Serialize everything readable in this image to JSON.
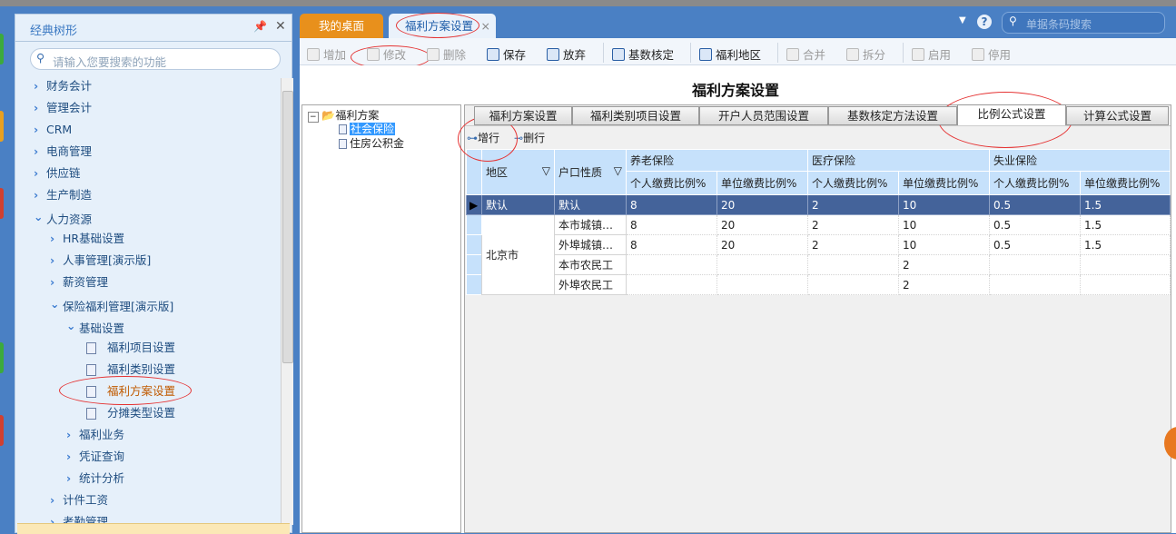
{
  "sidebar": {
    "title": "经典树形",
    "search_placeholder": "请输入您要搜索的功能",
    "items": [
      {
        "label": "财务会计",
        "level": 0,
        "state": "collapsed"
      },
      {
        "label": "管理会计",
        "level": 0,
        "state": "collapsed"
      },
      {
        "label": "CRM",
        "level": 0,
        "state": "collapsed"
      },
      {
        "label": "电商管理",
        "level": 0,
        "state": "collapsed"
      },
      {
        "label": "供应链",
        "level": 0,
        "state": "collapsed"
      },
      {
        "label": "生产制造",
        "level": 0,
        "state": "collapsed"
      },
      {
        "label": "人力资源",
        "level": 0,
        "state": "expanded"
      },
      {
        "label": "HR基础设置",
        "level": 1,
        "state": "collapsed"
      },
      {
        "label": "人事管理[演示版]",
        "level": 1,
        "state": "collapsed"
      },
      {
        "label": "薪资管理",
        "level": 1,
        "state": "collapsed"
      },
      {
        "label": "保险福利管理[演示版]",
        "level": 1,
        "state": "expanded"
      },
      {
        "label": "基础设置",
        "level": 2,
        "state": "expanded"
      },
      {
        "label": "福利项目设置",
        "level": 3,
        "state": "leaf"
      },
      {
        "label": "福利类别设置",
        "level": 3,
        "state": "leaf"
      },
      {
        "label": "福利方案设置",
        "level": 3,
        "state": "leaf",
        "active": true
      },
      {
        "label": "分摊类型设置",
        "level": 3,
        "state": "leaf"
      },
      {
        "label": "福利业务",
        "level": 2,
        "state": "collapsed"
      },
      {
        "label": "凭证查询",
        "level": 2,
        "state": "collapsed"
      },
      {
        "label": "统计分析",
        "level": 2,
        "state": "collapsed"
      },
      {
        "label": "计件工资",
        "level": 1,
        "state": "collapsed"
      },
      {
        "label": "考勤管理",
        "level": 1,
        "state": "collapsed"
      }
    ]
  },
  "tabs": [
    {
      "label": "我的桌面"
    },
    {
      "label": "福利方案设置",
      "active": true,
      "close": "×"
    }
  ],
  "barcode_search_placeholder": "单据条码搜索",
  "toolbar": [
    {
      "label": "增加",
      "enabled": false
    },
    {
      "label": "修改",
      "enabled": false
    },
    {
      "label": "删除",
      "enabled": false
    },
    {
      "label": "保存",
      "enabled": true
    },
    {
      "label": "放弃",
      "enabled": true
    },
    {
      "label": "基数核定",
      "enabled": true
    },
    {
      "label": "福利地区",
      "enabled": true
    },
    {
      "label": "合并",
      "enabled": false
    },
    {
      "label": "拆分",
      "enabled": false
    },
    {
      "label": "启用",
      "enabled": false
    },
    {
      "label": "停用",
      "enabled": false
    }
  ],
  "page_title": "福利方案设置",
  "plan_tree": {
    "root": "福利方案",
    "children": [
      "社会保险",
      "住房公积金"
    ],
    "selected": "社会保险"
  },
  "grid_tabs": [
    "福利方案设置",
    "福利类别项目设置",
    "开户人员范围设置",
    "基数核定方法设置",
    "比例公式设置",
    "计算公式设置"
  ],
  "active_grid_tab": "比例公式设置",
  "grid_toolbar": {
    "add_row": "增行",
    "delete_row": "删行"
  },
  "table": {
    "col_region": "地区",
    "col_hukou": "户口性质",
    "groups": [
      "养老保险",
      "医疗保险",
      "失业保险"
    ],
    "sub_cols": [
      "个人缴费比例%",
      "单位缴费比例%"
    ],
    "rows": [
      {
        "region": "默认",
        "hukou": "默认",
        "values": [
          "8",
          "20",
          "2",
          "10",
          "0.5",
          "1.5"
        ],
        "selected": true
      },
      {
        "region": "北京市",
        "hukou": "本市城镇…",
        "values": [
          "8",
          "20",
          "2",
          "10",
          "0.5",
          "1.5"
        ]
      },
      {
        "region": "",
        "hukou": "外埠城镇…",
        "values": [
          "8",
          "20",
          "2",
          "10",
          "0.5",
          "1.5"
        ]
      },
      {
        "region": "",
        "hukou": "本市农民工",
        "values": [
          "",
          "",
          "",
          "2",
          "",
          ""
        ]
      },
      {
        "region": "",
        "hukou": "外埠农民工",
        "values": [
          "",
          "",
          "",
          "2",
          "",
          ""
        ]
      }
    ]
  }
}
